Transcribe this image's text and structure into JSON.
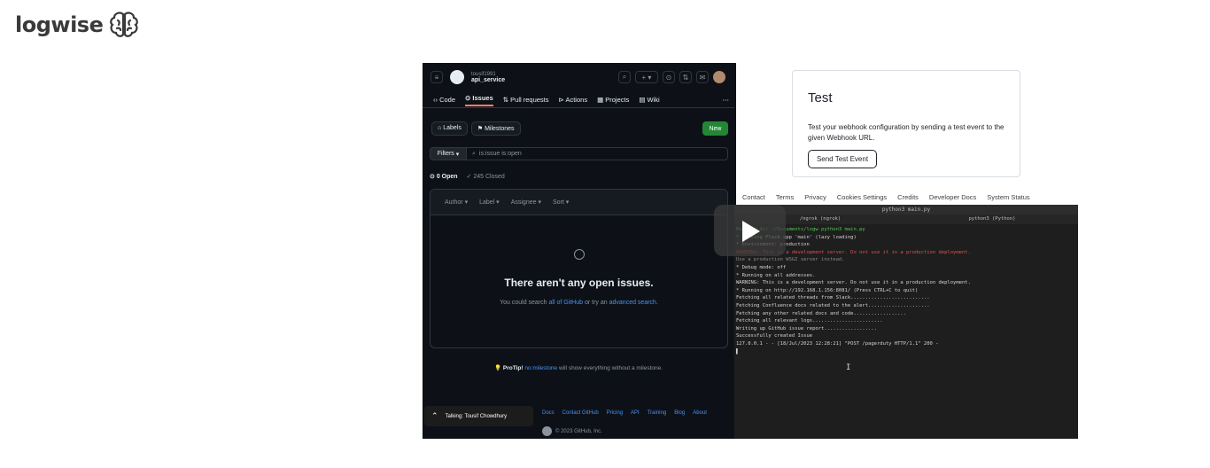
{
  "logo": {
    "text": "logwise"
  },
  "video": {
    "github": {
      "owner": "tousif1991",
      "repo": "api_service",
      "nav": [
        "Code",
        "Issues",
        "Pull requests",
        "Actions",
        "Projects",
        "Wiki"
      ],
      "labels_btn": "Labels",
      "milestones_btn": "Milestones",
      "new_btn": "New",
      "filters_btn": "Filters",
      "search_value": "is:issue is:open",
      "open_count": "0 Open",
      "closed_count": "245 Closed",
      "sort_options": [
        "Author",
        "Label",
        "Assignee",
        "Sort"
      ],
      "empty_title": "There aren't any open issues.",
      "empty_sub_prefix": "You could search",
      "empty_sub_link1": "all of GitHub",
      "empty_sub_mid": "or try an",
      "empty_sub_link2": "advanced search.",
      "protip_label": "ProTip!",
      "protip_link": "no:milestone",
      "protip_rest": "will show everything without a milestone.",
      "footer_links": [
        "Docs",
        "Contact GitHub",
        "Pricing",
        "API",
        "Training",
        "Blog",
        "About"
      ],
      "copyright": "© 2023 GitHub, Inc."
    },
    "talking": "Talking: Tousif Chowdhury",
    "webhook": {
      "title": "Test",
      "description": "Test your webhook configuration by sending a test event to the given Webhook URL.",
      "send_button": "Send Test Event",
      "footer": [
        "Contact",
        "Terms",
        "Privacy",
        "Cookies Settings",
        "Credits",
        "Developer Docs",
        "System Status"
      ]
    },
    "terminal": {
      "title": "python3 main.py",
      "tabs": [
        "/ngrok (ngrok)",
        "python3 (Python)"
      ],
      "lines": [
        "MacBook-Air ~/Documents/logw python3 main.py",
        " * Serving Flask app 'main' (lazy loading)",
        " * Environment: production",
        "   WARNING: This is a development server. Do not use it in a production deployment.",
        "   Use a production WSGI server instead.",
        " * Debug mode: off",
        " * Running on all addresses.",
        "   WARNING: This is a development server. Do not use it in a production deployment.",
        " * Running on http://192.168.1.156:8081/ (Press CTRL+C to quit)",
        "Fetching all related threads from Slack...........................",
        "Fetching Confluence docs related to the alert.....................",
        "Fetching any other related docs and code..................",
        "Fetching all relevant logs........................",
        "Writing up GitHub issue report..................",
        "Successfully created Issue",
        "127.0.0.1 - - [18/Jul/2023 12:28:21] \"POST /pagerduty HTTP/1.1\" 200 -",
        "▌"
      ]
    }
  },
  "colors": {
    "github_bg": "#0d1117",
    "new_button": "#238636",
    "link": "#4493f8",
    "terminal_error": "#d9534f",
    "terminal_green": "#4ec94e"
  }
}
